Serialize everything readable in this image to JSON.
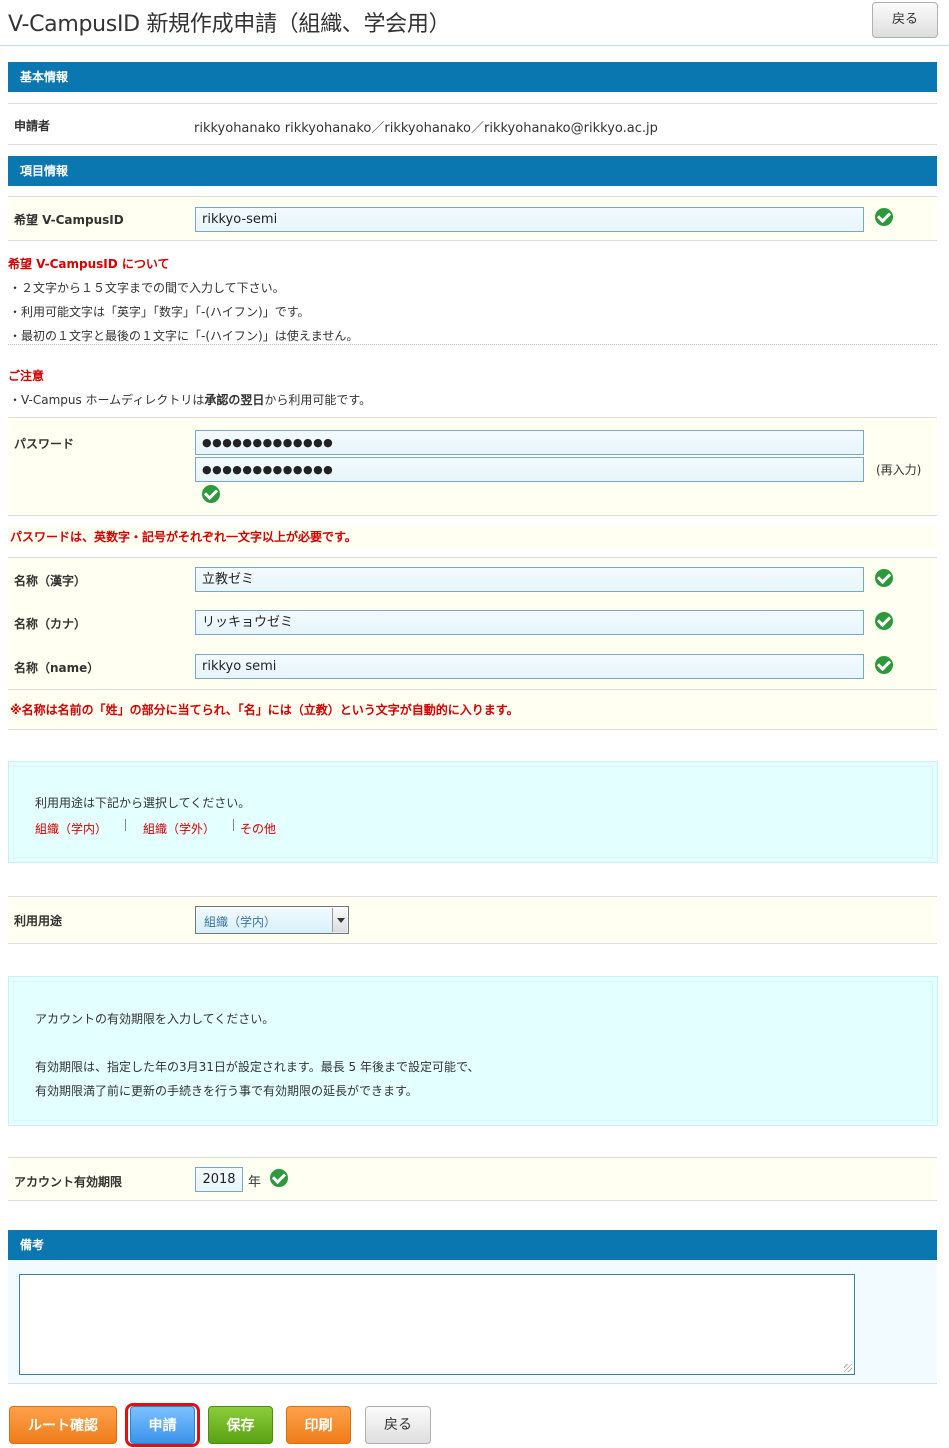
{
  "header": {
    "title": "V-CampusID 新規作成申請（組織、学会用）",
    "back_label": "戻る"
  },
  "sections": {
    "basic": "基本情報",
    "items": "項目情報",
    "remarks": "備考"
  },
  "applicant": {
    "label": "申請者",
    "value": "rikkyohanako  rikkyohanako／rikkyohanako／rikkyohanako@rikkyo.ac.jp"
  },
  "desired_id": {
    "label": "希望 V-CampusID",
    "value": "rikkyo-semi"
  },
  "id_notes": {
    "heading": "希望 V-CampusID について",
    "lines": [
      "・２文字から１５文字までの間で入力して下さい。",
      "・利用可能文字は「英字」「数字」「-(ハイフン)」です。",
      "・最初の１文字と最後の１文字に「-(ハイフン)」は使えません。"
    ]
  },
  "caution": {
    "heading": "ご注意",
    "line_prefix": "・V-Campus ホームディレクトリは",
    "line_bold": "承認の翌日",
    "line_suffix": "から利用可能です。"
  },
  "password": {
    "label": "パスワード",
    "value1": "●●●●●●●●●●●●●",
    "value2": "●●●●●●●●●●●●●",
    "reenter_label": "(再入力)",
    "rule_note": "パスワードは、英数字・記号がそれぞれ一文字以上が必要です。"
  },
  "names": {
    "kanji_label": "名称（漢字）",
    "kanji_value": "立教ゼミ",
    "kana_label": "名称（カナ）",
    "kana_value": "リッキョウゼミ",
    "name_label": "名称（name）",
    "name_value": "rikkyo semi",
    "note": "※名称は名前の「姓」の部分に当てられ、「名」には（立教）という文字が自動的に入ります。"
  },
  "usage_info": {
    "text": "利用用途は下記から選択してください。",
    "links": [
      "組織（学内）",
      "組織（学外）",
      "その他"
    ]
  },
  "usage": {
    "label": "利用用途",
    "selected": "組織（学内）"
  },
  "expiry_info": {
    "line1": "アカウントの有効期限を入力してください。",
    "line2": "有効期限は、指定した年の3月31日が設定されます。最長 5 年後まで設定可能で、",
    "line3": "有効期限満了前に更新の手続きを行う事で有効期限の延長ができます。"
  },
  "expiry": {
    "label": "アカウント有効期限",
    "year": "2018",
    "unit": "年"
  },
  "remarks": {
    "value": ""
  },
  "footer_buttons": {
    "route_check": "ルート確認",
    "apply": "申請",
    "save": "保存",
    "print": "印刷",
    "back": "戻る"
  },
  "colors": {
    "section_header": "#0a77b0",
    "error_red": "#d40000",
    "check_green": "#2c9a3a",
    "info_bg": "#e3ffff",
    "row_cream": "#fffff2"
  }
}
